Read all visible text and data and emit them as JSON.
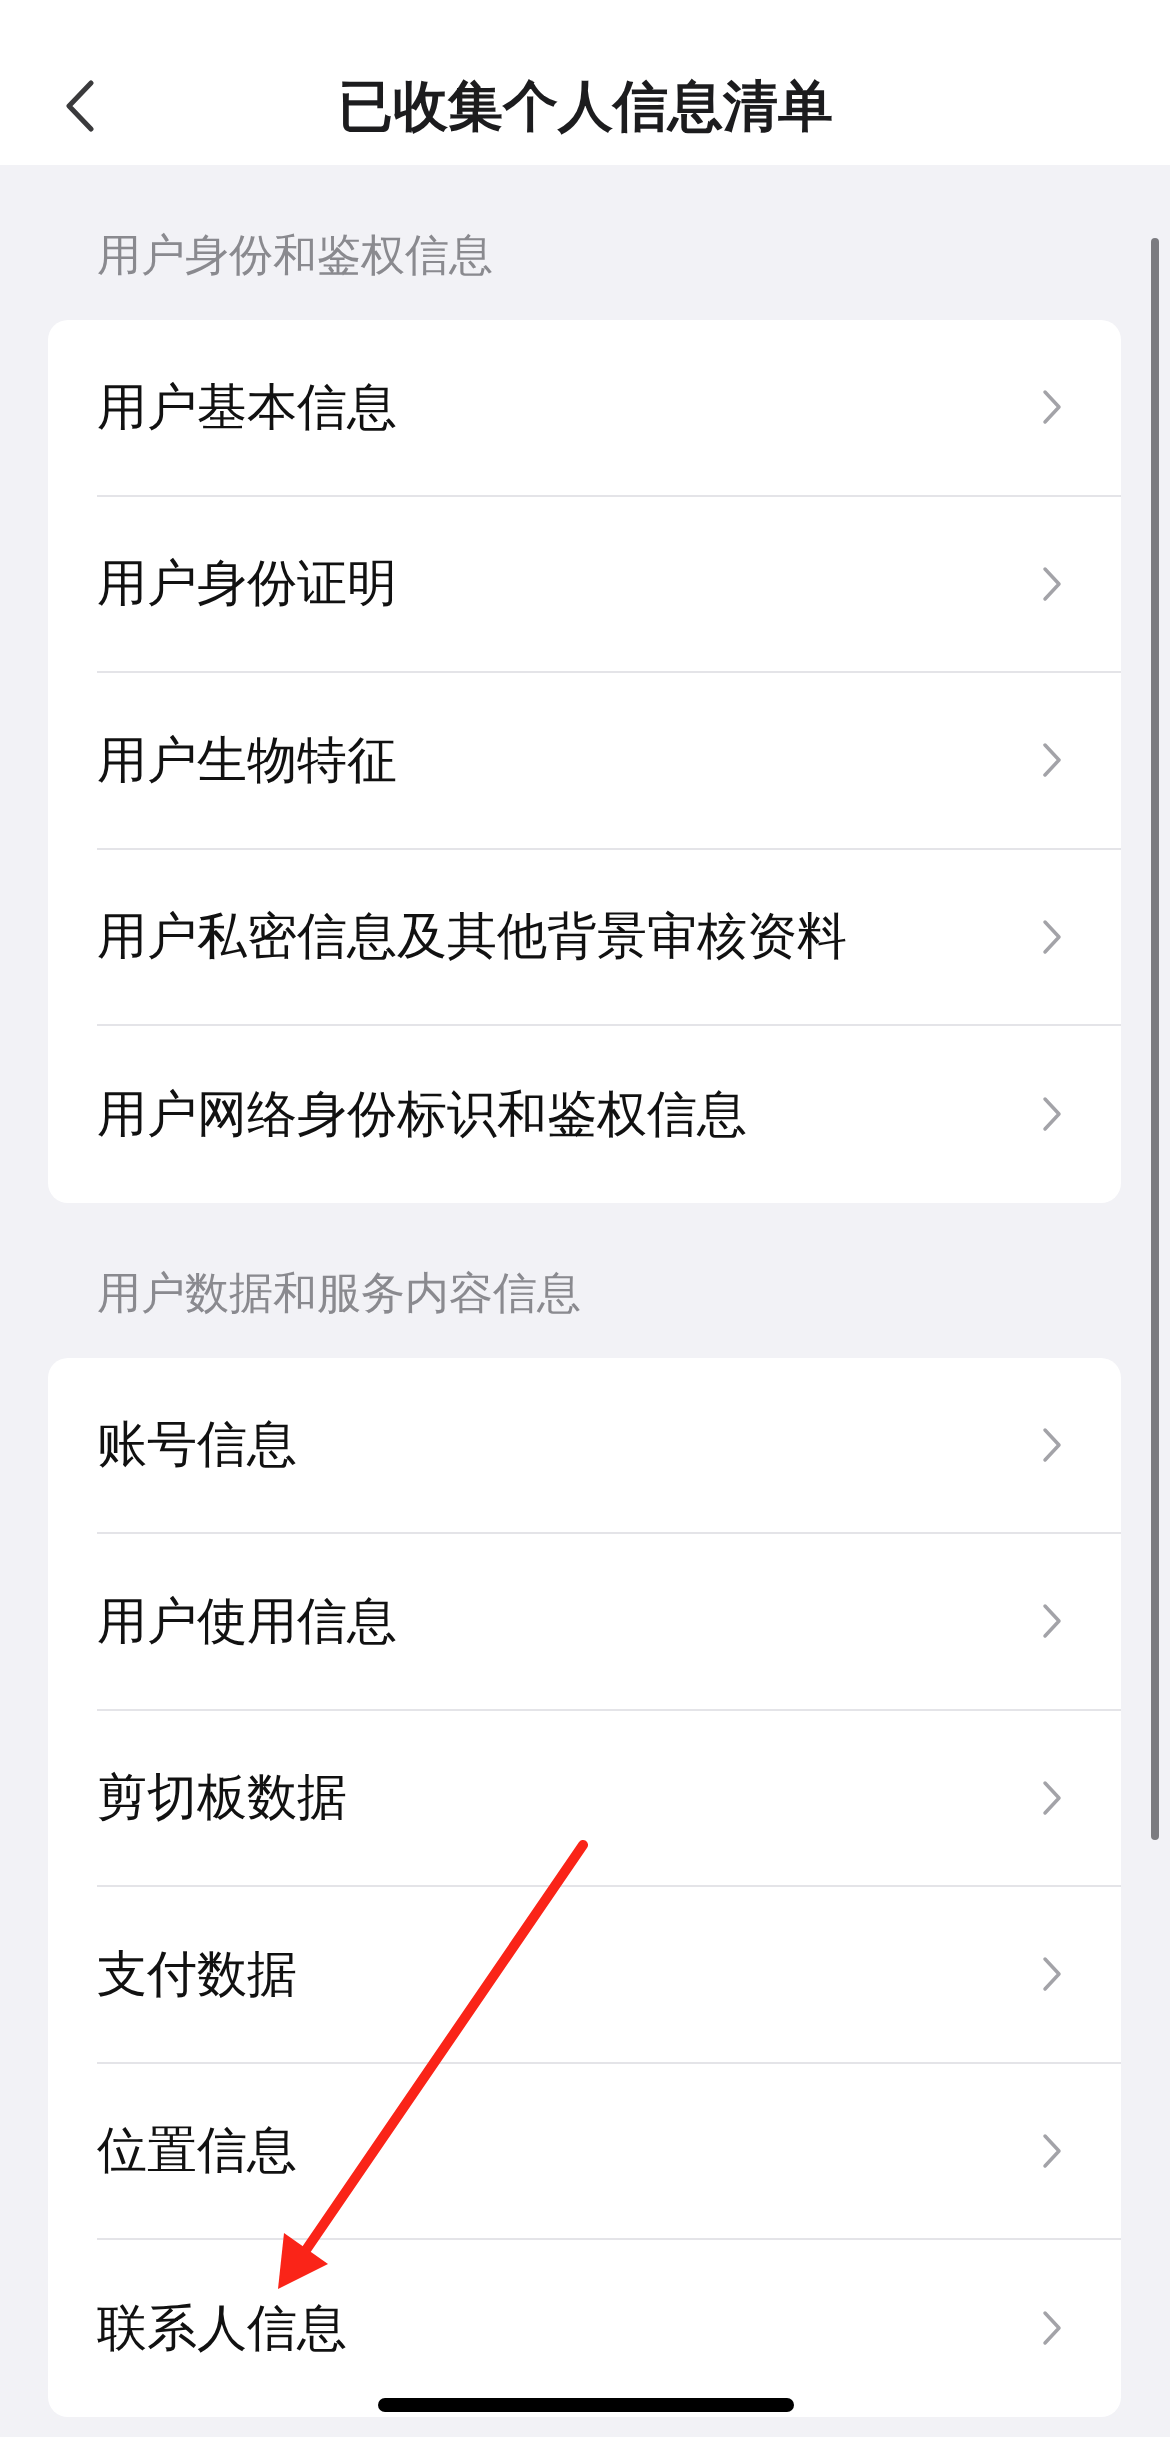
{
  "header": {
    "title": "已收集个人信息清单"
  },
  "sections": [
    {
      "title": "用户身份和鉴权信息",
      "items": [
        "用户基本信息",
        "用户身份证明",
        "用户生物特征",
        "用户私密信息及其他背景审核资料",
        "用户网络身份标识和鉴权信息"
      ]
    },
    {
      "title": "用户数据和服务内容信息",
      "items": [
        "账号信息",
        "用户使用信息",
        "剪切板数据",
        "支付数据",
        "位置信息",
        "联系人信息"
      ]
    }
  ]
}
